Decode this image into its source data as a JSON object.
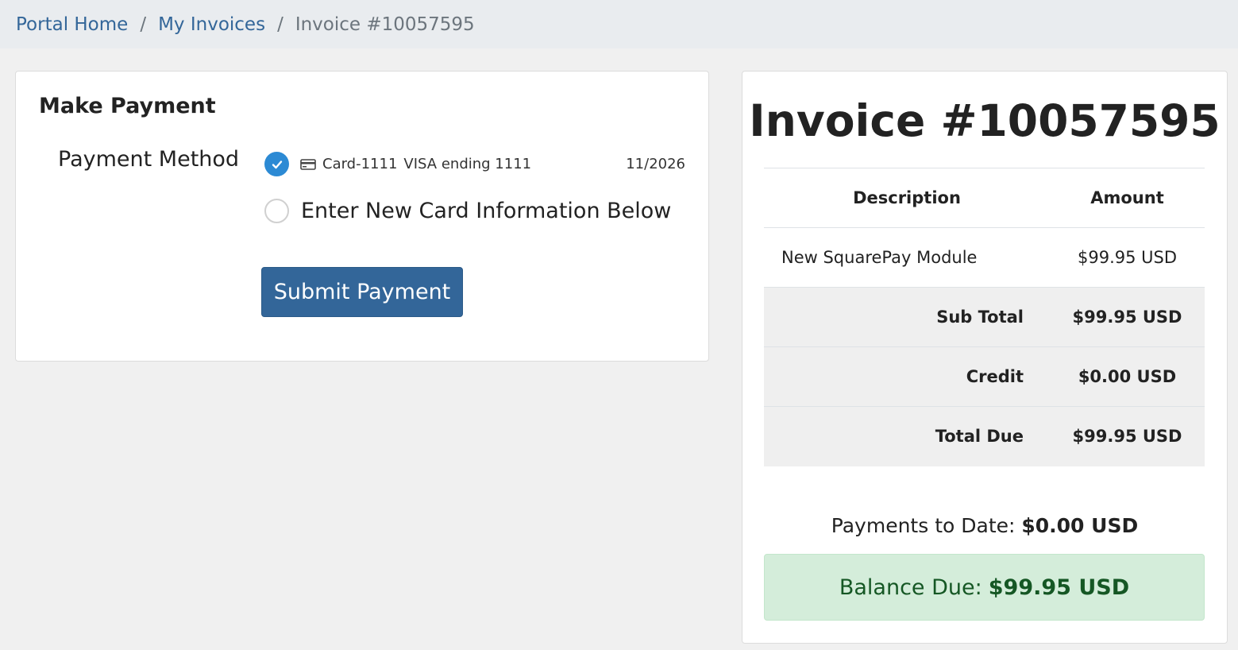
{
  "breadcrumb": {
    "items": [
      "Portal Home",
      "My Invoices"
    ],
    "separator": "/",
    "current": "Invoice #10057595"
  },
  "payment": {
    "title": "Make Payment",
    "method_label": "Payment Method",
    "saved_card": {
      "name": "Card-1111",
      "description": "VISA ending 1111",
      "expiry": "11/2026",
      "selected": true,
      "icon": "credit-card-icon"
    },
    "new_card_label": "Enter New Card Information Below",
    "submit_label": "Submit Payment"
  },
  "invoice": {
    "title": "Invoice #10057595",
    "columns": {
      "description": "Description",
      "amount": "Amount"
    },
    "items": [
      {
        "description": "New SquarePay Module",
        "amount": "$99.95 USD"
      }
    ],
    "totals": [
      {
        "label": "Sub Total",
        "amount": "$99.95 USD"
      },
      {
        "label": "Credit",
        "amount": "$0.00 USD"
      },
      {
        "label": "Total Due",
        "amount": "$99.95 USD"
      }
    ],
    "payments_label": "Payments to Date:",
    "payments_value": "$0.00 USD",
    "balance_label": "Balance Due:",
    "balance_value": "$99.95 USD"
  },
  "colors": {
    "link": "#336699",
    "primary_button": "#336699",
    "radio_checked": "#2c8ad4",
    "balance_bg": "#d4edda",
    "balance_text": "#155724"
  }
}
